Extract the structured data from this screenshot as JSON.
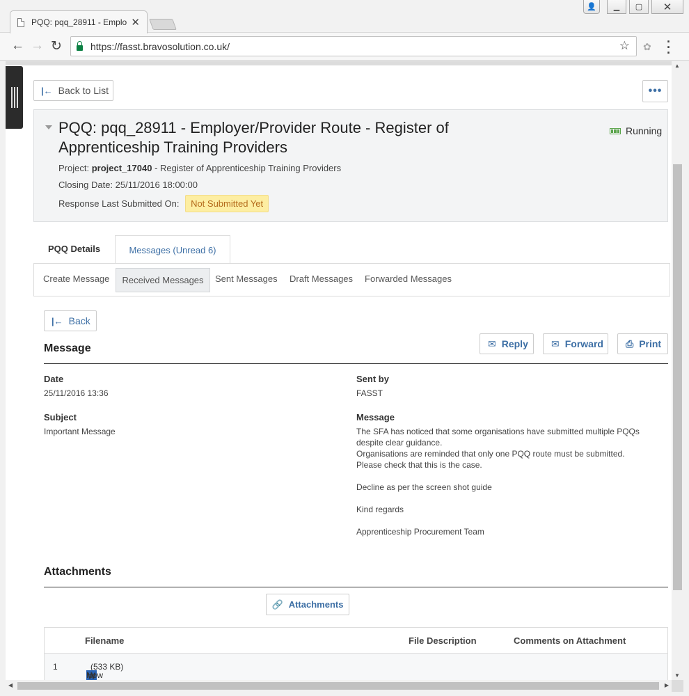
{
  "browser": {
    "tab_title": "PQQ: pqq_28911 - Emplo",
    "tab_close": "✕",
    "url": "https://fasst.bravosolution.co.uk/"
  },
  "page": {
    "back_to_list": "Back to List",
    "more": "•••",
    "title": "PQQ: pqq_28911 - Employer/Provider Route - Register of Apprenticeship Training Providers",
    "status": "Running",
    "project_label": "Project:",
    "project_code": "project_17040",
    "project_name": " - Register of Apprenticeship Training Providers",
    "closing_label": "Closing Date:",
    "closing_date": "25/11/2016 18:00:00",
    "response_label": "Response Last Submitted On:",
    "response_value": "Not Submitted Yet",
    "tabs": [
      "PQQ Details",
      "Messages (Unread 6)"
    ],
    "subnav": [
      "Create Message",
      "Received Messages",
      "Sent Messages",
      "Draft Messages",
      "Forwarded Messages"
    ],
    "back": "Back",
    "message_heading": "Message",
    "reply": "Reply",
    "forward": "Forward",
    "print": "Print",
    "date_label": "Date",
    "date_value": "25/11/2016 13:36",
    "sent_by_label": "Sent by",
    "sent_by_value": "FASST",
    "subject_label": "Subject",
    "subject_value": "Important Message",
    "message_label": "Message",
    "message_lines": [
      "The SFA has noticed that some organisations have submitted multiple PQQs",
      "despite clear guidance.",
      "Organisations are reminded that only one PQQ route must be submitted.",
      "Please check that this is the case.",
      "",
      "Decline as per the screen shot guide",
      "",
      "Kind regards",
      "",
      "Apprenticeship Procurement Team"
    ],
    "attachments_heading": "Attachments",
    "attachments_button": "Attachments",
    "attachment_columns": [
      "Filename",
      "File Description",
      "Comments on Attachment"
    ],
    "attachment_rows": [
      {
        "index": "1",
        "filename": "How Does a Bidder formally DECLINE to bi...",
        "size": "(533 KB)"
      }
    ]
  },
  "colors": {
    "accent": "#3d6fa5",
    "status_green": "#5aa44b",
    "badge_bg": "#fdeea2",
    "badge_text": "#b46a1b"
  }
}
